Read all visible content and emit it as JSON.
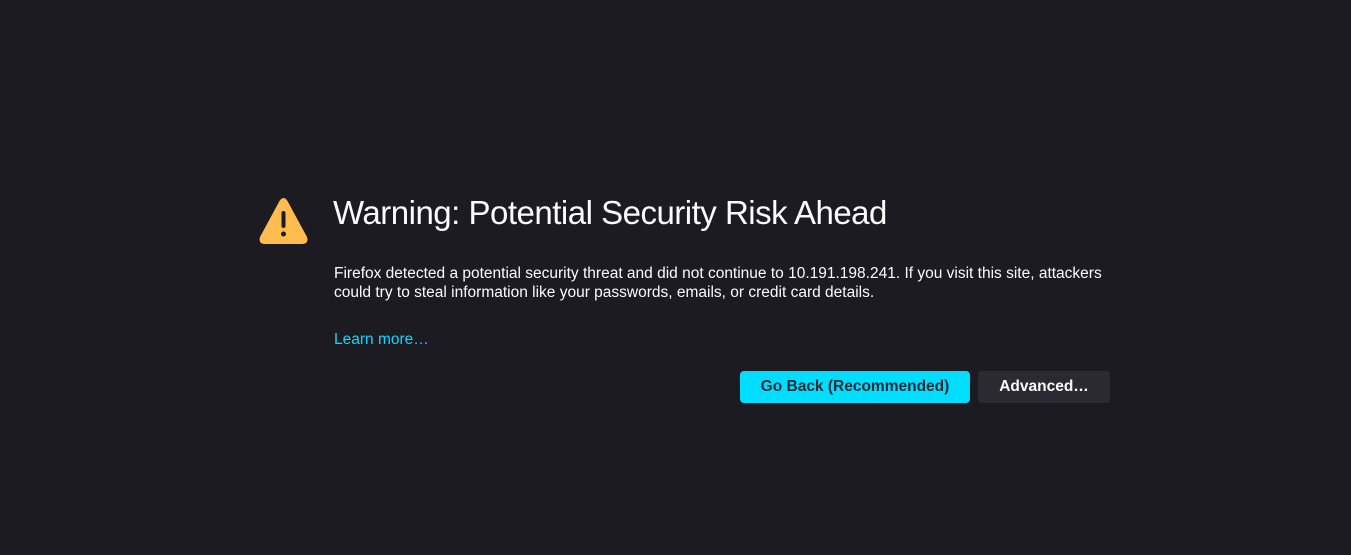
{
  "colors": {
    "background": "#1c1b22",
    "accent": "#00ddff",
    "warning": "#ffbd4f",
    "secondary_button": "#2b2a33"
  },
  "error": {
    "icon": "warning-triangle-icon",
    "title": "Warning: Potential Security Risk Ahead",
    "description": "Firefox detected a potential security threat and did not continue to 10.191.198.241. If you visit this site, attackers could try to steal information like your passwords, emails, or credit card details.",
    "learn_more": "Learn more…",
    "go_back_label": "Go Back (Recommended)",
    "advanced_label": "Advanced…"
  }
}
